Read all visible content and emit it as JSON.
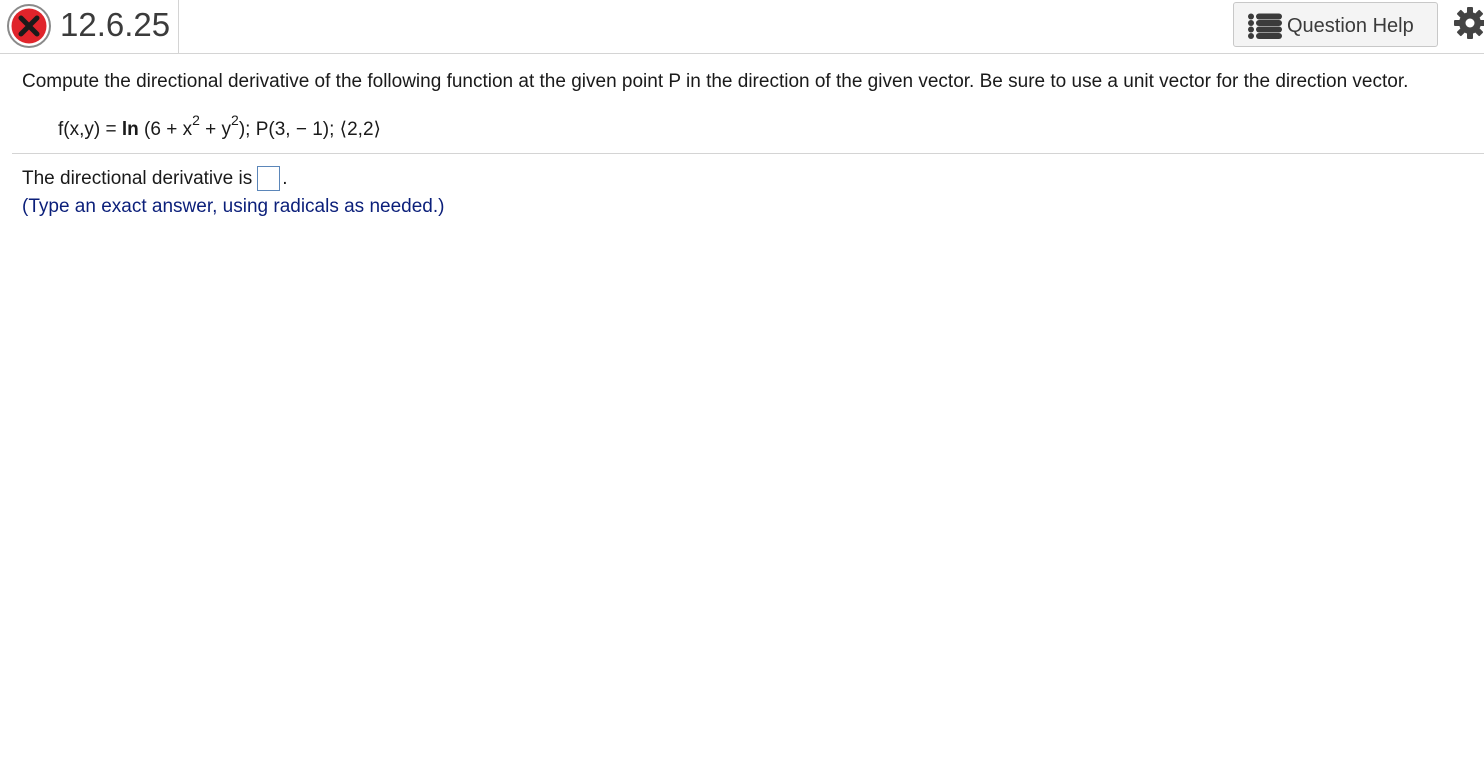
{
  "header": {
    "status_icon": "incorrect-x-icon",
    "question_number": "12.6.25",
    "help_button_label": "Question Help",
    "help_icon": "list-icon",
    "settings_icon": "gear-icon"
  },
  "question": {
    "prompt": "Compute the directional derivative of the following function at the given point P in the direction of the given vector. Be sure to use a unit vector for the direction vector.",
    "formula": {
      "lhs": "f(x,y) = ",
      "fn": "ln",
      "part1": " (6 + x",
      "exp1": "2",
      "part2": " + y",
      "exp2": "2",
      "part3": "); P(3, − 1); ⟨2,2⟩"
    },
    "answer_label": "The directional derivative is",
    "answer_value": "",
    "answer_suffix": ".",
    "hint": "(Type an exact answer, using radicals as needed.)"
  },
  "colors": {
    "error_red": "#e0242b",
    "hint_blue": "#0b1f7a",
    "box_border": "#5b86b9"
  }
}
